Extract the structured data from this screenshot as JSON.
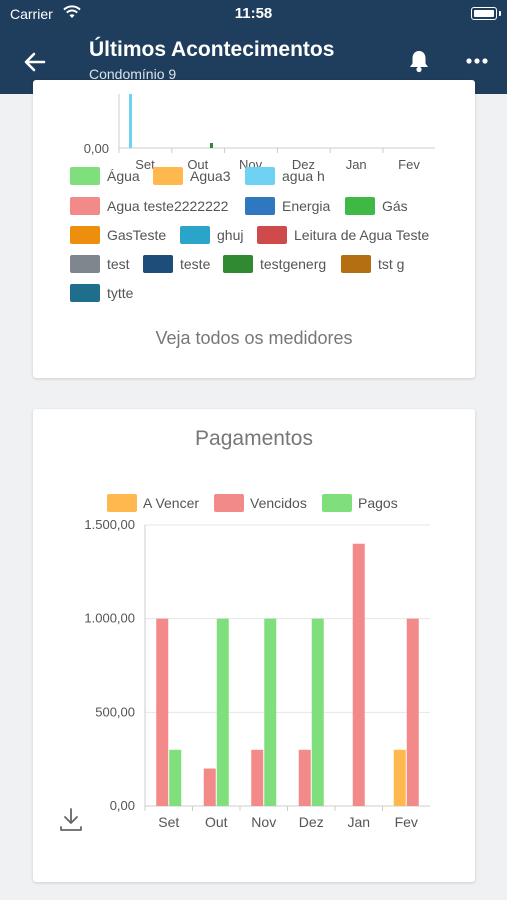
{
  "status_bar": {
    "carrier": "Carrier",
    "time": "11:58"
  },
  "header": {
    "title": "Últimos Acontecimentos",
    "subtitle": "Condomínio 9"
  },
  "meters_card": {
    "x_tick_labels": [
      "Set",
      "Out",
      "Nov",
      "Dez",
      "Jan",
      "Fev"
    ],
    "y_tick_label": "0,00",
    "legend": [
      {
        "label": "Água",
        "color": "#7edf7c"
      },
      {
        "label": "Agua3",
        "color": "#ffb84d"
      },
      {
        "label": "agua h",
        "color": "#6fd2f2"
      },
      {
        "label": "Agua teste2222222",
        "color": "#f28a8a"
      },
      {
        "label": "Energia",
        "color": "#2f78bf"
      },
      {
        "label": "Gás",
        "color": "#3fb944"
      },
      {
        "label": "GasTeste",
        "color": "#ed8f0c"
      },
      {
        "label": "ghuj",
        "color": "#2aa4c9"
      },
      {
        "label": "Leitura de Agua Teste",
        "color": "#cf4a4a"
      },
      {
        "label": "test",
        "color": "#7f868d"
      },
      {
        "label": "teste",
        "color": "#1e4d7a"
      },
      {
        "label": "testgenerg",
        "color": "#2f8a31"
      },
      {
        "label": "tst g",
        "color": "#b36f10"
      },
      {
        "label": "tytte",
        "color": "#1f6e8c"
      }
    ],
    "see_all_label": "Veja todos os medidores"
  },
  "payments_card": {
    "title": "Pagamentos"
  },
  "chart_data": {
    "type": "bar",
    "title": "Pagamentos",
    "categories": [
      "Set",
      "Out",
      "Nov",
      "Dez",
      "Jan",
      "Fev"
    ],
    "series": [
      {
        "name": "A Vencer",
        "color": "#ffb84d",
        "values": [
          0,
          0,
          0,
          0,
          0,
          300
        ]
      },
      {
        "name": "Vencidos",
        "color": "#f28a8a",
        "values": [
          1000,
          200,
          300,
          300,
          1400,
          1000
        ]
      },
      {
        "name": "Pagos",
        "color": "#7edf7c",
        "values": [
          300,
          1000,
          1000,
          1000,
          0,
          0
        ]
      }
    ],
    "ylim": [
      0,
      1500
    ],
    "yticks": [
      0,
      500,
      1000,
      1500
    ],
    "ytick_labels": [
      "0,00",
      "500,00",
      "1.000,00",
      "1.500,00"
    ],
    "grid": true,
    "legend": "top"
  }
}
